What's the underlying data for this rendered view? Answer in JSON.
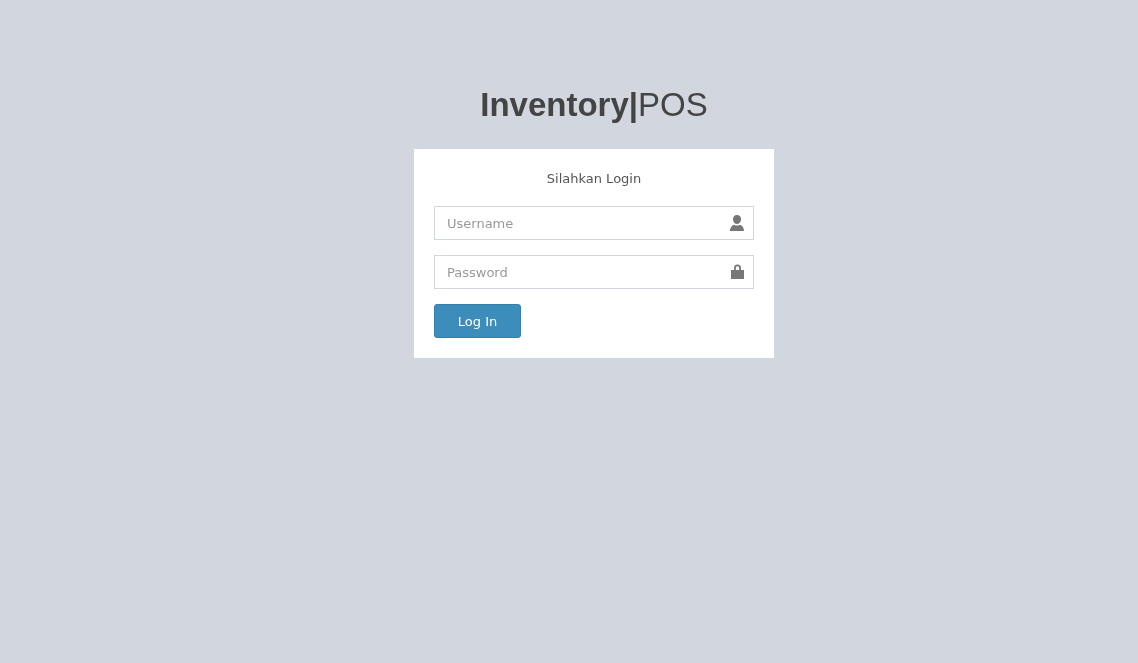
{
  "logo": "**Inventory|**POS",
  "login_box": {
    "message": "Silahkan Login",
    "fields": [
      {
        "kind": "user",
        "placeholder": "Username"
      },
      {
        "kind": "lock",
        "placeholder": "Password"
      }
    ],
    "button": "Log In"
  }
}
